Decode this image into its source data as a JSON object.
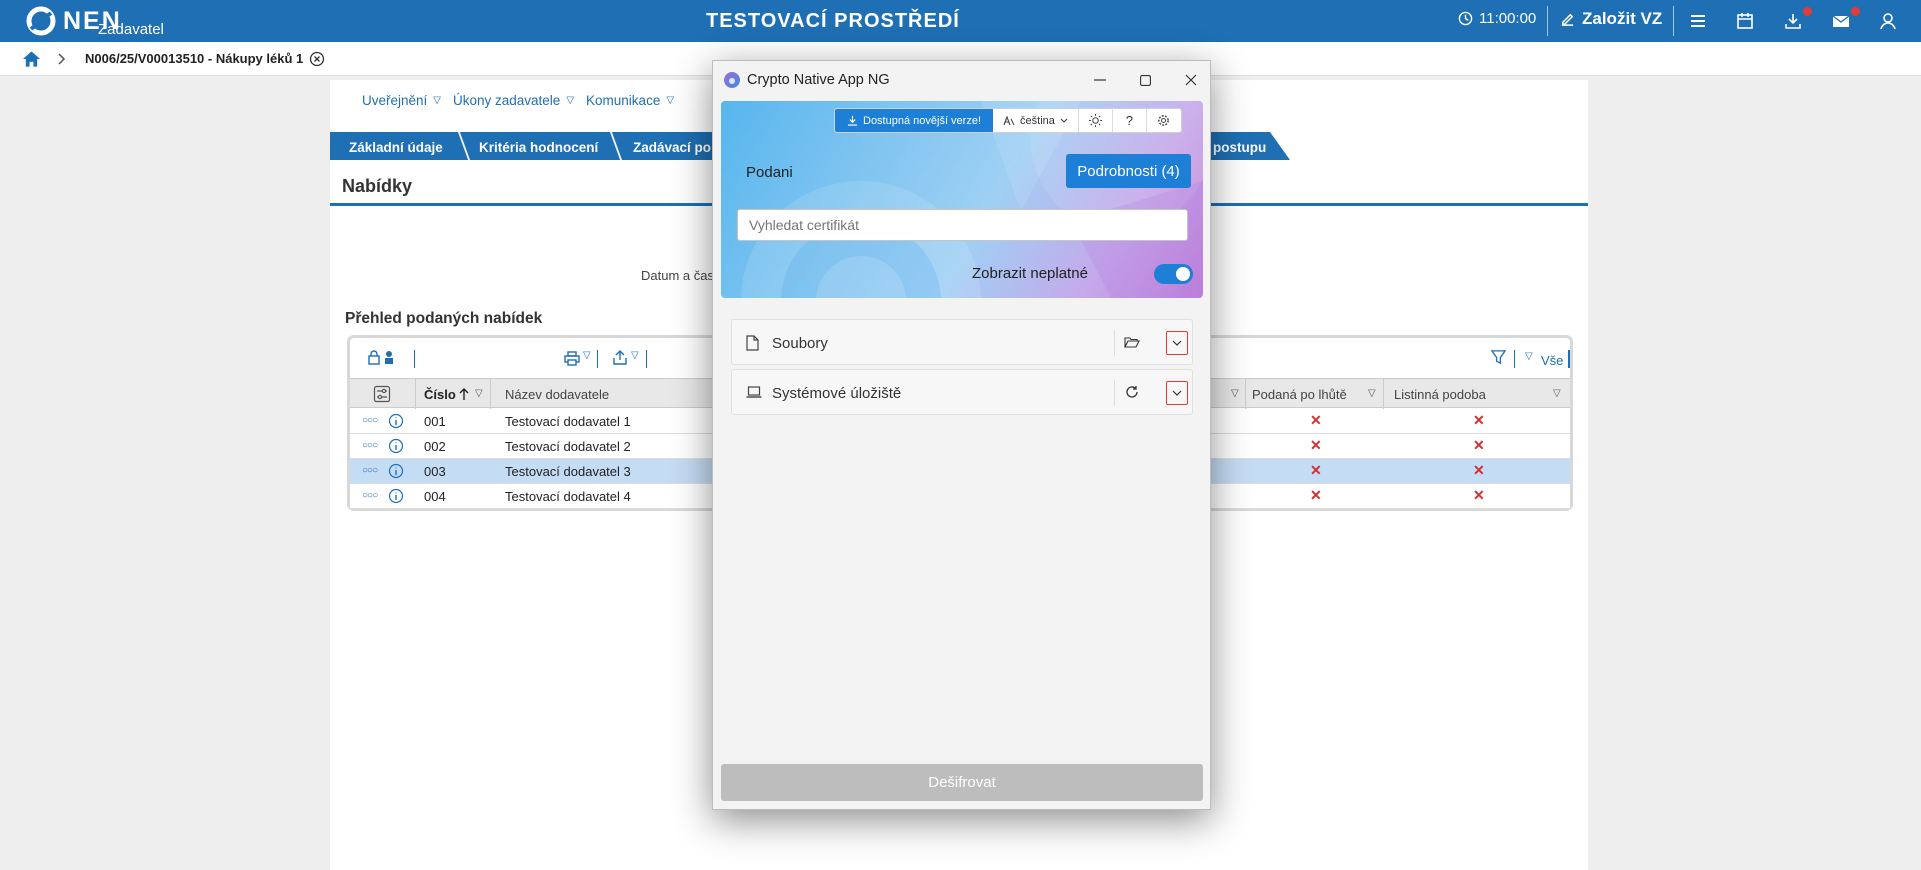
{
  "header": {
    "logo_text": "NEN",
    "logo_sub": "Zadavatel",
    "env_title": "TESTOVACÍ PROSTŘEDÍ",
    "time": "11:00:00",
    "create_label": "Založit VZ",
    "accent": "#1e6fb3"
  },
  "breadcrumb": {
    "text": "N006/25/V00013510 - Nákupy léků 1"
  },
  "toolbar": {
    "items": [
      "Uveřejnění",
      "Úkony zadavatele",
      "Komunikace"
    ]
  },
  "tabs": [
    {
      "label": "Základní údaje"
    },
    {
      "label": "Kritéria hodnocení"
    },
    {
      "label": "Zadávací po"
    },
    {
      "label": "postupu"
    }
  ],
  "section": {
    "title": "Nabídky",
    "datum_label": "Datum a čas",
    "overview_title": "Přehled podaných nabídek",
    "filter_all": "Vše"
  },
  "table": {
    "columns": {
      "cislo": "Číslo",
      "nazev": "Název dodavatele",
      "podana": "Podaná po lhůtě",
      "listinna": "Listinná podoba"
    },
    "rows": [
      {
        "cislo": "001",
        "nazev": "Testovací dodavatel 1",
        "selected": false
      },
      {
        "cislo": "002",
        "nazev": "Testovací dodavatel 2",
        "selected": false
      },
      {
        "cislo": "003",
        "nazev": "Testovací dodavatel 3",
        "selected": true
      },
      {
        "cislo": "004",
        "nazev": "Testovací dodavatel 4",
        "selected": false
      }
    ]
  },
  "dialog": {
    "title": "Crypto Native App NG",
    "update_label": "Dostupná novější verze!",
    "language": "čeština",
    "podani": "Podani",
    "details_button": "Podrobnosti (4)",
    "search_placeholder": "Vyhledat certifikát",
    "toggle_label": "Zobrazit neplatné",
    "toggle_on": true,
    "sections": [
      {
        "label": "Soubory"
      },
      {
        "label": "Systémové úložiště"
      }
    ],
    "decrypt_button": "Dešifrovat",
    "accent": "#1e7fd6"
  }
}
